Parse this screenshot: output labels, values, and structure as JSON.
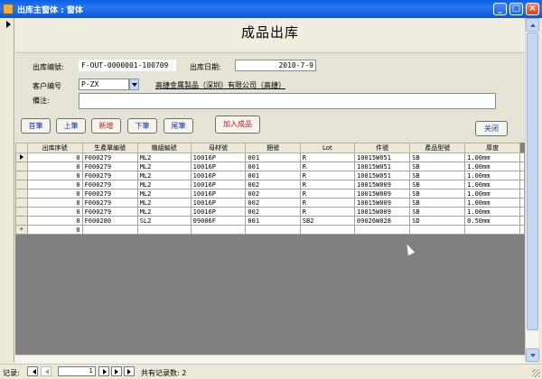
{
  "window": {
    "title": "出库主窗体 : 窗体",
    "minimize_glyph": "_",
    "maximize_glyph": "□",
    "close_glyph": "×"
  },
  "form": {
    "title": "成品出库",
    "outbound_no_label": "出库编號:",
    "outbound_no_value": "F-OUT-0000001-100709",
    "outbound_date_label": "出库日期:",
    "outbound_date_value": "2010-7-9",
    "customer_no_label": "客户编号",
    "customer_no_value": "P-ZX",
    "company_name": "高捷金属製品（深圳）有限公司（高捷）",
    "remark_label": "備注:",
    "remark_value": ""
  },
  "buttons": {
    "first": "首筆",
    "prev": "上筆",
    "new": "新增",
    "next": "下筆",
    "last": "尾筆",
    "add_product": "加入成品",
    "close": "关闭"
  },
  "grid": {
    "columns": [
      "出库序號",
      "生產單編號",
      "機組編號",
      "母材號",
      "捆號",
      "Lot",
      "件號",
      "產品型號",
      "厚度"
    ],
    "rows": [
      {
        "seq": "0",
        "order": "F000279",
        "unit": "ML2",
        "mat": "10016P",
        "bundle": "001",
        "lot": "R",
        "part": "10015W051",
        "model": "SB",
        "thick": "1.00mm"
      },
      {
        "seq": "0",
        "order": "F000279",
        "unit": "ML2",
        "mat": "10016P",
        "bundle": "001",
        "lot": "R",
        "part": "10015W051",
        "model": "SB",
        "thick": "1.00mm"
      },
      {
        "seq": "0",
        "order": "F000279",
        "unit": "ML2",
        "mat": "10016P",
        "bundle": "001",
        "lot": "R",
        "part": "10015W051",
        "model": "SB",
        "thick": "1.00mm"
      },
      {
        "seq": "0",
        "order": "F000279",
        "unit": "ML2",
        "mat": "10016P",
        "bundle": "002",
        "lot": "R",
        "part": "10015W009",
        "model": "SB",
        "thick": "1.00mm"
      },
      {
        "seq": "0",
        "order": "F000279",
        "unit": "ML2",
        "mat": "10016P",
        "bundle": "002",
        "lot": "R",
        "part": "10015W009",
        "model": "SB",
        "thick": "1.00mm"
      },
      {
        "seq": "0",
        "order": "F000279",
        "unit": "ML2",
        "mat": "10016P",
        "bundle": "002",
        "lot": "R",
        "part": "10015W009",
        "model": "SB",
        "thick": "1.00mm"
      },
      {
        "seq": "0",
        "order": "F000279",
        "unit": "ML2",
        "mat": "10016P",
        "bundle": "002",
        "lot": "R",
        "part": "10015W009",
        "model": "SB",
        "thick": "1.00mm"
      },
      {
        "seq": "0",
        "order": "F000280",
        "unit": "SL2",
        "mat": "09006F",
        "bundle": "001",
        "lot": "SB2",
        "part": "09026W028",
        "model": "SD",
        "thick": "0.50mm"
      }
    ],
    "new_row": {
      "marker": "*",
      "seq": "0"
    }
  },
  "statusbar": {
    "record_label": "记录:",
    "current_record": "1",
    "total_label": "共有记录数: 2"
  },
  "icons": {
    "window_icon": "form-icon",
    "row_pointer": "record-pointer-icon",
    "new_row_marker": "new-record-icon"
  }
}
